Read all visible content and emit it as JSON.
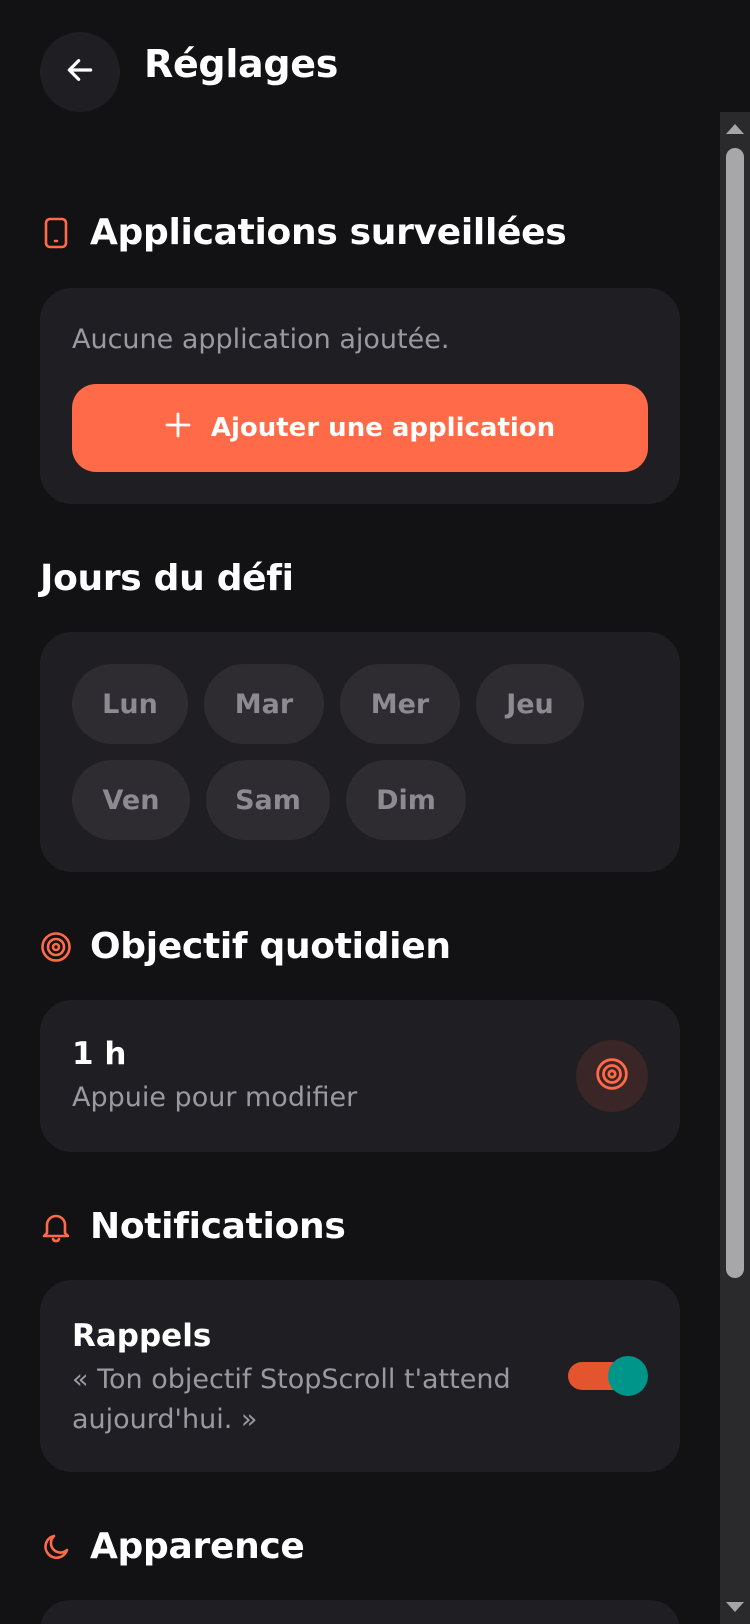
{
  "header": {
    "title": "Réglages",
    "back_icon": "arrow-left-icon"
  },
  "apps": {
    "title": "Applications surveillées",
    "icon": "smartphone-icon",
    "empty_text": "Aucune application ajoutée.",
    "add_label": "Ajouter une application"
  },
  "days": {
    "title": "Jours du défi",
    "items": [
      "Lun",
      "Mar",
      "Mer",
      "Jeu",
      "Ven",
      "Sam",
      "Dim"
    ]
  },
  "goal": {
    "title": "Objectif quotidien",
    "icon": "target-icon",
    "value": "1 h",
    "hint": "Appuie pour modifier"
  },
  "notifications": {
    "title": "Notifications",
    "icon": "bell-icon",
    "reminder_title": "Rappels",
    "reminder_line1": "« Ton objectif StopScroll t'attend",
    "reminder_line2": "aujourd'hui. »",
    "enabled": true
  },
  "appearance": {
    "title": "Apparence",
    "icon": "moon-icon"
  },
  "colors": {
    "accent": "#ff6a48",
    "background": "#121114",
    "card": "#1f1e22",
    "toggle_knob": "#00958a"
  }
}
